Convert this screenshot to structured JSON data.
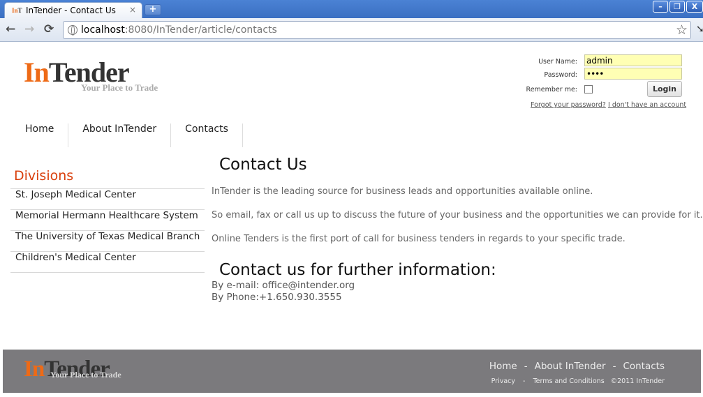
{
  "browser": {
    "tab_title": "InTender - Contact Us",
    "tab_favicon_in": "In",
    "tab_favicon_t": "T",
    "tab_close": "×",
    "new_tab": "+",
    "url_host": "localhost",
    "url_rest": ":8080/InTender/article/contacts",
    "back_glyph": "←",
    "forward_glyph": "→",
    "reload_glyph": "⟳",
    "star_glyph": "☆",
    "minimize_glyph": "–",
    "restore_glyph": "❐",
    "close_glyph": "X"
  },
  "header": {
    "logo_in": "In",
    "logo_tender": "Tender",
    "tagline": "Your Place to Trade"
  },
  "login": {
    "username_label": "User Name:",
    "username_value": "admin",
    "password_label": "Password:",
    "password_value": "••••",
    "remember_label": "Remember me:",
    "remember_checked": false,
    "login_button": "Login",
    "forgot_link": "Forgot your password?",
    "no_account_link": "I don't have an account"
  },
  "nav": {
    "items": [
      {
        "label": "Home"
      },
      {
        "label": "About InTender"
      },
      {
        "label": "Contacts"
      }
    ]
  },
  "sidebar": {
    "title": "Divisions",
    "items": [
      {
        "label": "St. Joseph Medical Center"
      },
      {
        "label": "Memorial Hermann Healthcare System"
      },
      {
        "label": "The University of Texas Medical Branch"
      },
      {
        "label": "Children's Medical Center"
      }
    ]
  },
  "main": {
    "title": "Contact Us",
    "paragraphs": [
      "InTender is the leading source for business leads and opportunities available online.",
      "So email, fax or call us up to discuss the future of your business and the opportunities we can provide for it.",
      "Online Tenders is the first port of call for business tenders in regards to your specific trade."
    ],
    "subtitle": "Contact us for further information:",
    "email_line": "By e-mail: office@intender.org",
    "phone_line": "By Phone:+1.650.930.3555"
  },
  "footer": {
    "logo_in": "In",
    "logo_tender": "Tender",
    "tagline": "Your Place to Trade",
    "nav": [
      {
        "label": "Home"
      },
      {
        "label": "About InTender"
      },
      {
        "label": "Contacts"
      }
    ],
    "nav_separator": "-",
    "legal": {
      "privacy": "Privacy",
      "separator": "-",
      "terms": "Terms and Conditions",
      "copyright": "©2011 InTender"
    }
  },
  "colors": {
    "brand_orange": "#ee6a16",
    "division_title": "#d9400d",
    "footer_bg": "#7b7a7d",
    "login_input_bg": "#ffffb4"
  },
  "icons": {
    "address_bar": "globe-icon",
    "bookmark": "star-icon",
    "menu": "wrench-icon"
  }
}
